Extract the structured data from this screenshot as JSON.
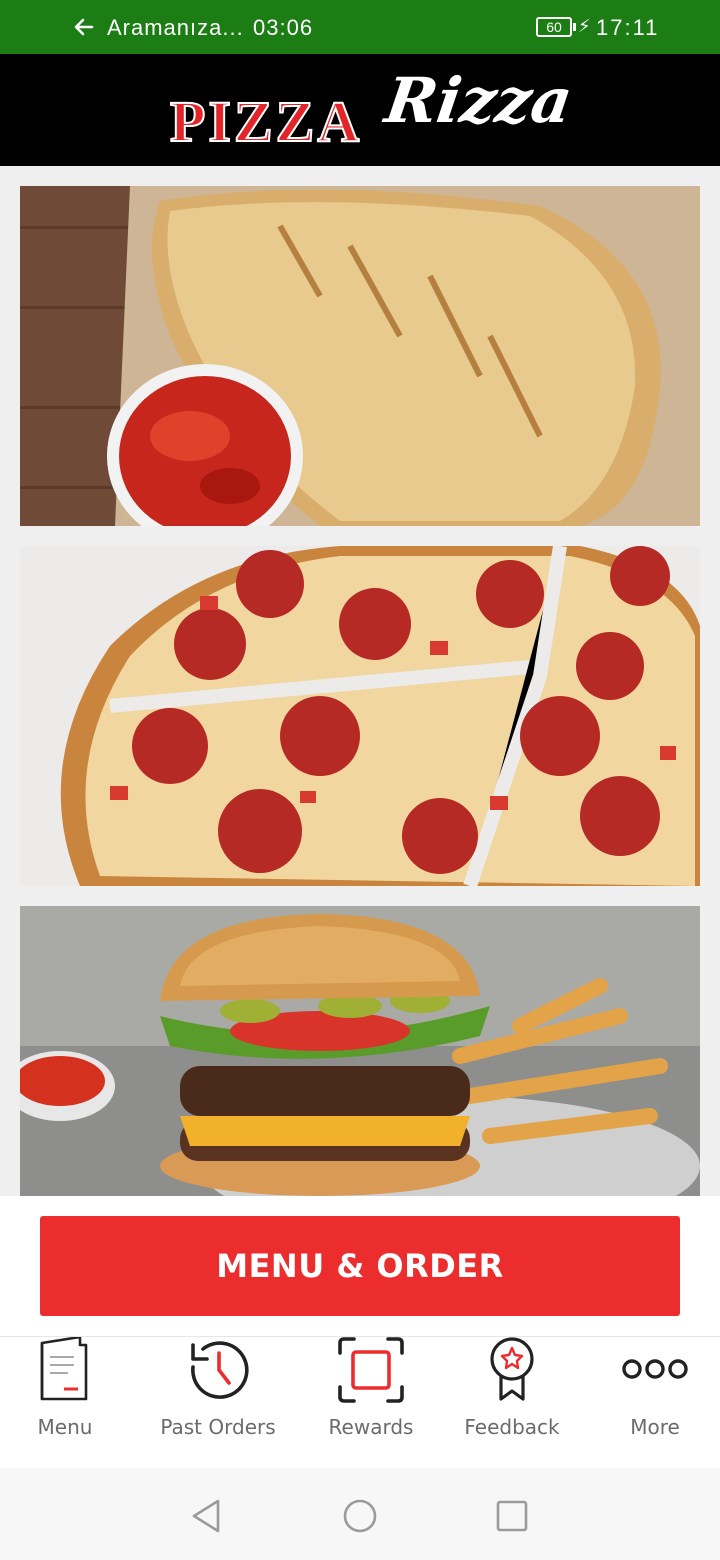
{
  "status_bar": {
    "app_label": "Aramanıza...",
    "time": "03:06",
    "battery": "60",
    "clock": "17:11"
  },
  "header": {
    "logo_word_1": "PIZZA",
    "logo_word_2": "Rizza"
  },
  "cta": {
    "label": "MENU & ORDER"
  },
  "bottom_nav": {
    "items": [
      {
        "label": "Menu",
        "icon": "menu-icon"
      },
      {
        "label": "Past Orders",
        "icon": "past-orders-icon"
      },
      {
        "label": "Rewards",
        "icon": "rewards-icon"
      },
      {
        "label": "Feedback",
        "icon": "feedback-icon"
      },
      {
        "label": "More",
        "icon": "more-icon"
      }
    ]
  },
  "colors": {
    "status_bar": "#1b7d14",
    "accent": "#ec2d2e",
    "header_bg": "#000000",
    "icon": "#222222"
  }
}
